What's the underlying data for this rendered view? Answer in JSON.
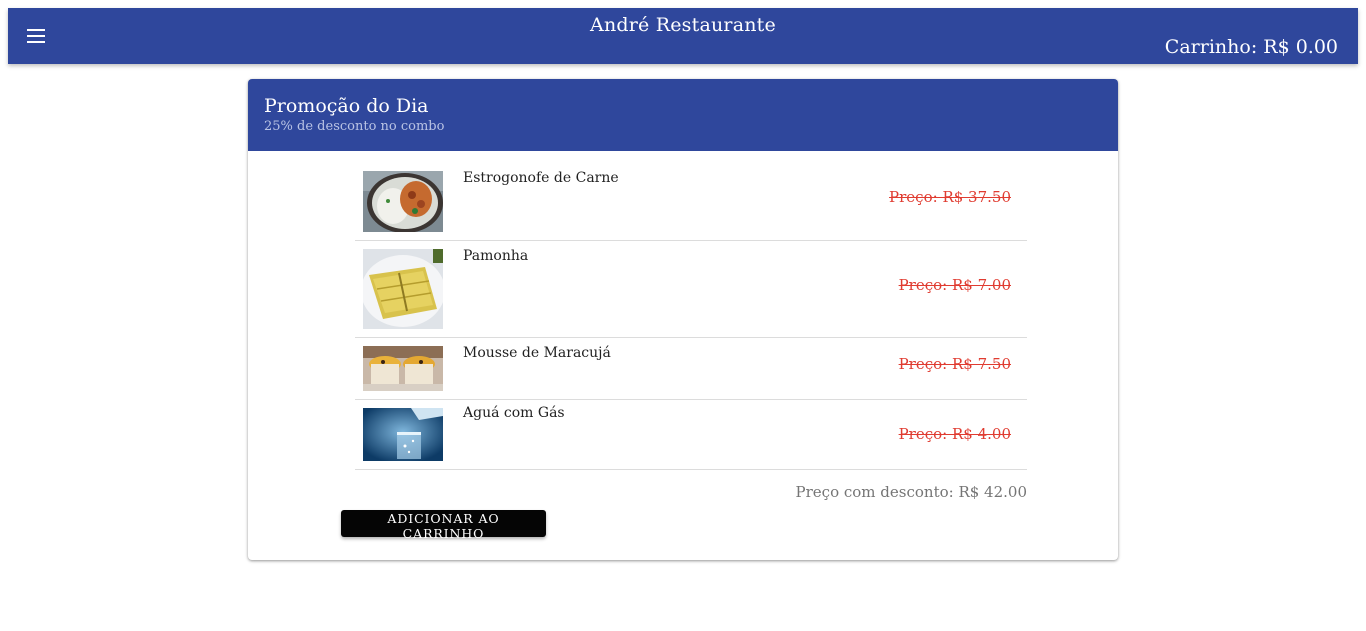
{
  "header": {
    "title": "André Restaurante",
    "cart_label": "Carrinho: R$ 0.00"
  },
  "promo": {
    "title": "Promoção do Dia",
    "subtitle": "25% de desconto no combo",
    "items": [
      {
        "name": "Estrogonofe de Carne",
        "price": "Preço: R$ 37.50",
        "image": "stroganoff-dish-photo"
      },
      {
        "name": "Pamonha",
        "price": "Preço: R$ 7.00",
        "image": "pamonha-photo"
      },
      {
        "name": "Mousse de Maracujá",
        "price": "Preço: R$ 7.50",
        "image": "passion-fruit-mousse-photo"
      },
      {
        "name": "Aguá com Gás",
        "price": "Preço: R$ 4.00",
        "image": "sparkling-water-photo"
      }
    ],
    "discount_total": "Preço com desconto: R$ 42.00",
    "add_button": "ADICIONAR AO CARRINHO"
  },
  "colors": {
    "primary": "#2f479c",
    "strike_price": "#e03c31",
    "button": "#050505"
  }
}
